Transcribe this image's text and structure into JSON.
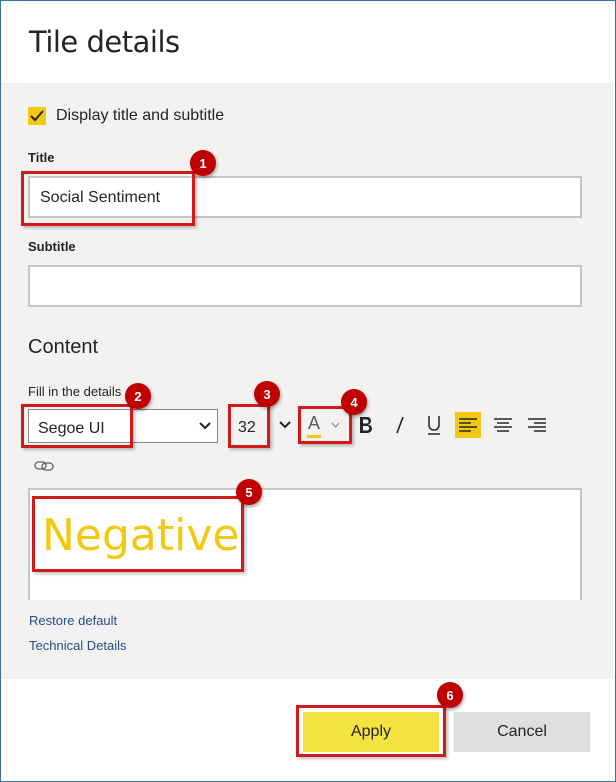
{
  "dialog": {
    "title": "Tile details"
  },
  "display_title": {
    "label": "Display title and subtitle",
    "checked": true
  },
  "title_field": {
    "label": "Title",
    "value": "Social Sentiment"
  },
  "subtitle_field": {
    "label": "Subtitle",
    "value": ""
  },
  "content": {
    "heading": "Content",
    "hint": "Fill in the details",
    "font_family": "Segoe UI",
    "font_size": "32",
    "font_color_glyph": "A",
    "editor_text": "Negative"
  },
  "links": {
    "restore": "Restore default",
    "technical": "Technical Details"
  },
  "buttons": {
    "apply": "Apply",
    "cancel": "Cancel"
  },
  "markers": [
    "1",
    "2",
    "3",
    "4",
    "5",
    "6"
  ],
  "colors": {
    "accent": "#f2c811",
    "apply": "#f5e342",
    "callout": "#d11a1a",
    "marker": "#c00000"
  }
}
